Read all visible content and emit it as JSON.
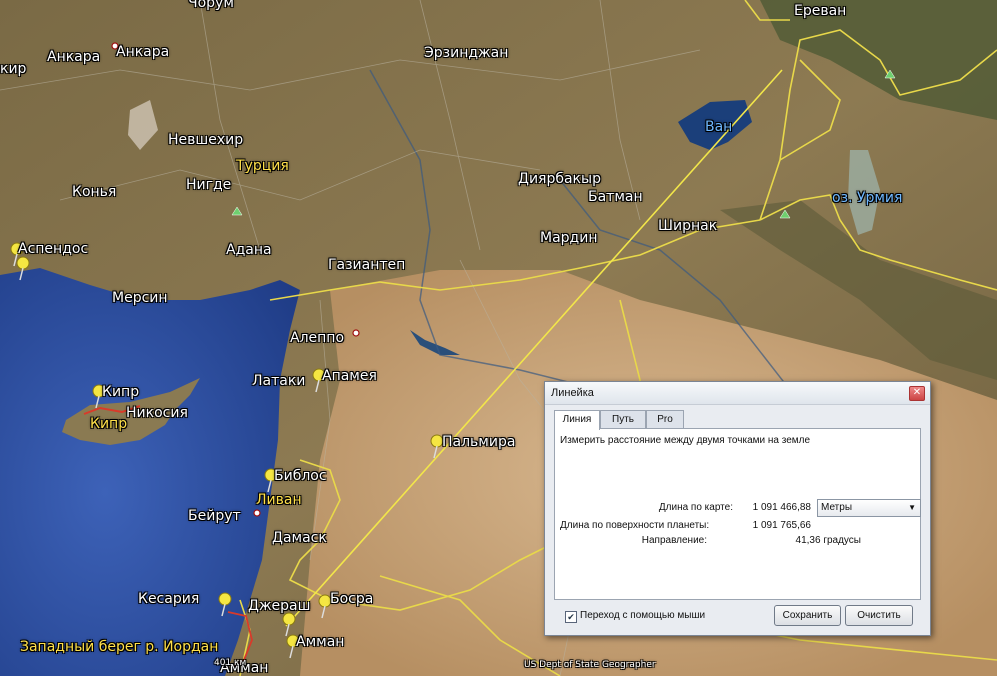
{
  "map": {
    "labels": [
      {
        "id": "label-chorum",
        "text": "Чорум",
        "kind": "city"
      },
      {
        "id": "label-erevan",
        "text": "Ереван",
        "kind": "city"
      },
      {
        "id": "label-kir",
        "text": "кир",
        "kind": "city"
      },
      {
        "id": "label-ankara-1",
        "text": "Анкара",
        "kind": "city"
      },
      {
        "id": "label-ankara-2",
        "text": "Анкара",
        "kind": "city"
      },
      {
        "id": "label-erzindzhan",
        "text": "Эрзинджан",
        "kind": "city"
      },
      {
        "id": "label-van",
        "text": "Ван",
        "kind": "lake"
      },
      {
        "id": "label-nevshehir",
        "text": "Невшехир",
        "kind": "city"
      },
      {
        "id": "label-turtsiya",
        "text": "Турция",
        "kind": "country"
      },
      {
        "id": "label-konya",
        "text": "Конья",
        "kind": "city"
      },
      {
        "id": "label-nigde",
        "text": "Нигде",
        "kind": "city"
      },
      {
        "id": "label-diyarbakyr",
        "text": "Диярбакыр",
        "kind": "city"
      },
      {
        "id": "label-batman",
        "text": "Батман",
        "kind": "city"
      },
      {
        "id": "label-urmiya",
        "text": "оз. Урмия",
        "kind": "lake"
      },
      {
        "id": "label-aspendos",
        "text": "Аспендос",
        "kind": "city"
      },
      {
        "id": "label-adana",
        "text": "Адана",
        "kind": "city"
      },
      {
        "id": "label-mardin",
        "text": "Мардин",
        "kind": "city"
      },
      {
        "id": "label-shirnak",
        "text": "Ширнак",
        "kind": "city"
      },
      {
        "id": "label-gaziantep",
        "text": "Газиантеп",
        "kind": "city"
      },
      {
        "id": "label-mersin",
        "text": "Мерсин",
        "kind": "city"
      },
      {
        "id": "label-aleppo",
        "text": "Алеппо",
        "kind": "city"
      },
      {
        "id": "label-latakiya",
        "text": "Латаки",
        "kind": "city"
      },
      {
        "id": "label-apameya",
        "text": "Апамея",
        "kind": "city"
      },
      {
        "id": "label-kipr-1",
        "text": "Кипр",
        "kind": "city"
      },
      {
        "id": "label-nikosiya",
        "text": "Никосия",
        "kind": "city"
      },
      {
        "id": "label-kipr-2",
        "text": "Кипр",
        "kind": "country"
      },
      {
        "id": "label-palmira",
        "text": "Пальмира",
        "kind": "city"
      },
      {
        "id": "label-biblos",
        "text": "Библос",
        "kind": "city"
      },
      {
        "id": "label-livan",
        "text": "Ливан",
        "kind": "country"
      },
      {
        "id": "label-beyrut",
        "text": "Бейрут",
        "kind": "city"
      },
      {
        "id": "label-damask",
        "text": "Дамаск",
        "kind": "city"
      },
      {
        "id": "label-kesariya",
        "text": "Кесария",
        "kind": "city"
      },
      {
        "id": "label-dzherash",
        "text": "Джераш",
        "kind": "city"
      },
      {
        "id": "label-bosra",
        "text": "Босра",
        "kind": "city"
      },
      {
        "id": "label-zapadny-bereg",
        "text": "Западный берег р. Иордан",
        "kind": "country"
      },
      {
        "id": "label-amman-1",
        "text": "Амман",
        "kind": "city"
      },
      {
        "id": "label-amman-2",
        "text": "Амман",
        "kind": "city"
      },
      {
        "id": "label-scale",
        "text": "401 км",
        "kind": "small"
      },
      {
        "id": "label-attribution",
        "text": "US Dept of State Geographer",
        "kind": "small"
      }
    ]
  },
  "ruler": {
    "title": "Линейка",
    "close_icon": "close-icon",
    "tabs": [
      {
        "label": "Линия",
        "active": true
      },
      {
        "label": "Путь",
        "active": false
      },
      {
        "label": "Pro",
        "active": false
      }
    ],
    "description": "Измерить расстояние между двумя точками на земле",
    "map_length_label": "Длина по карте:",
    "map_length_value": "1 091 466,88",
    "units_selected": "Метры",
    "ground_length_label": "Длина по поверхности планеты:",
    "ground_length_value": "1 091 765,66",
    "heading_label": "Направление:",
    "heading_value": "41,36 градусы",
    "mouse_nav_label": "Переход с помощью мыши",
    "mouse_nav_checked": true,
    "save_label": "Сохранить",
    "clear_label": "Очистить"
  },
  "colors": {
    "measure_line": "#f2e64a",
    "border_line": "#e8d84a",
    "sea": "#2c4f9e",
    "land": "#8a7750",
    "desert": "#c9a57a"
  }
}
